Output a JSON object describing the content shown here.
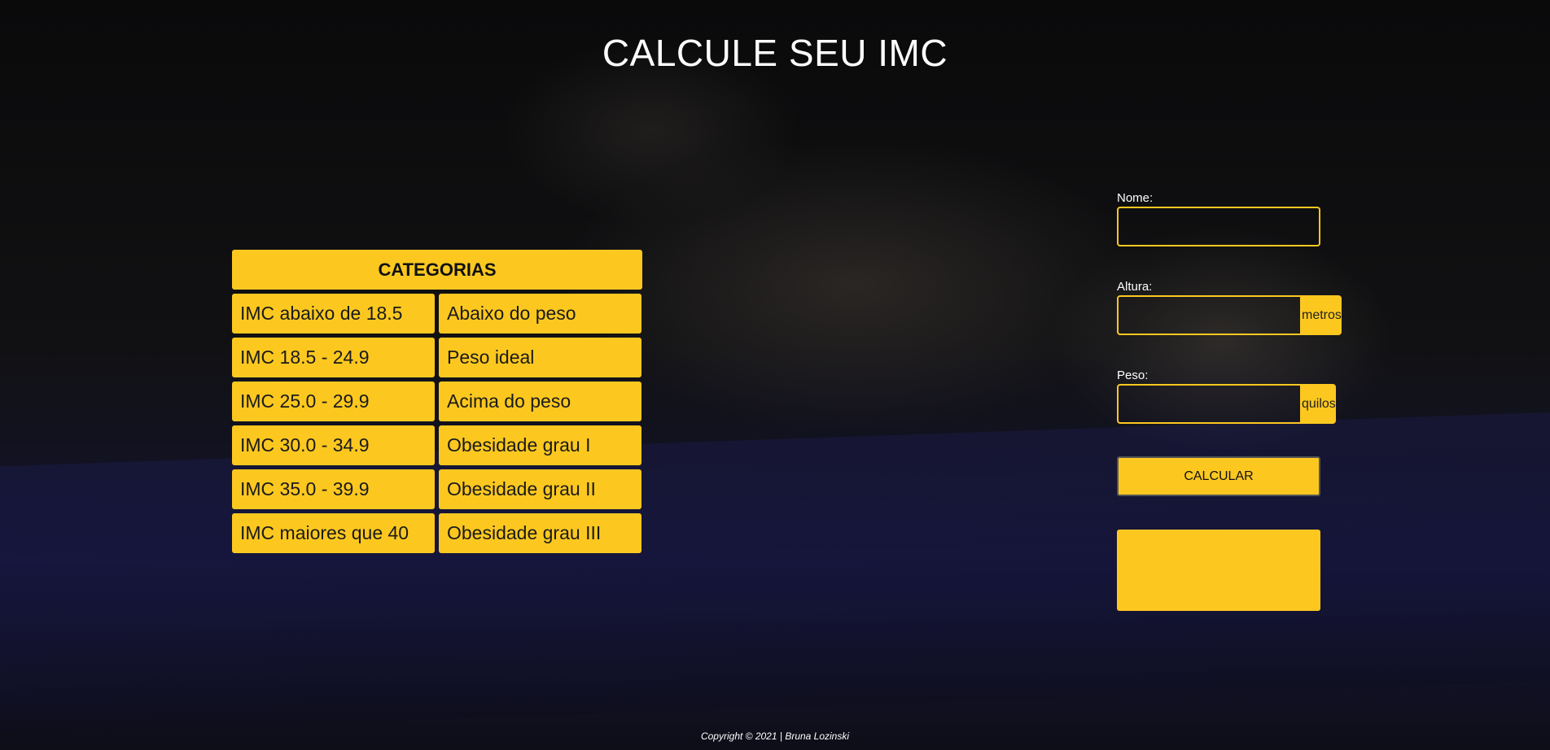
{
  "page": {
    "title": "CALCULE SEU IMC",
    "footer": "Copyright © 2021 | Bruna Lozinski"
  },
  "categories": {
    "header": "CATEGORIAS",
    "rows": [
      {
        "range": "IMC abaixo de 18.5",
        "label": "Abaixo do peso"
      },
      {
        "range": "IMC 18.5 - 24.9",
        "label": "Peso ideal"
      },
      {
        "range": "IMC 25.0 - 29.9",
        "label": "Acima do peso"
      },
      {
        "range": "IMC 30.0 - 34.9",
        "label": "Obesidade grau I"
      },
      {
        "range": "IMC 35.0 - 39.9",
        "label": "Obesidade grau II"
      },
      {
        "range": "IMC maiores que 40",
        "label": "Obesidade grau III"
      }
    ]
  },
  "form": {
    "nome": {
      "label": "Nome:",
      "value": "",
      "placeholder": ""
    },
    "altura": {
      "label": "Altura:",
      "value": "",
      "placeholder": "",
      "unit": "metros"
    },
    "peso": {
      "label": "Peso:",
      "value": "",
      "placeholder": "",
      "unit": "quilos"
    },
    "button_label": "CALCULAR",
    "result": ""
  },
  "colors": {
    "accent": "#fcc820",
    "text_on_accent": "#1a1a1a",
    "heading": "#ffffff"
  }
}
